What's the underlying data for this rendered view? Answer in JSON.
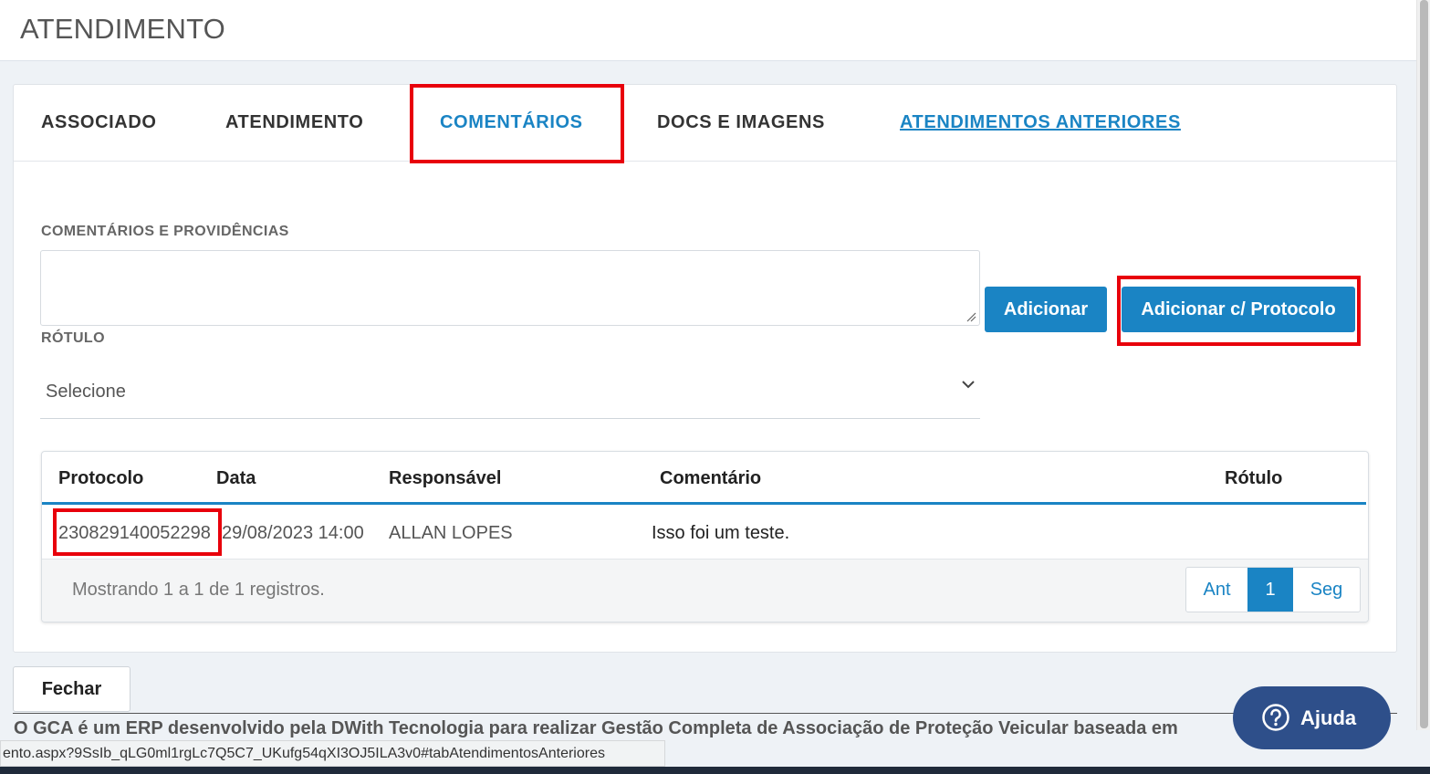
{
  "header": {
    "title": "ATENDIMENTO"
  },
  "tabs": [
    {
      "label": "ASSOCIADO"
    },
    {
      "label": "ATENDIMENTO"
    },
    {
      "label": "COMENTÁRIOS",
      "active": true
    },
    {
      "label": "DOCS E IMAGENS"
    },
    {
      "label": "ATENDIMENTOS ANTERIORES",
      "link": true
    }
  ],
  "form": {
    "comment_label": "COMENTÁRIOS E PROVIDÊNCIAS",
    "comment_value": "",
    "rotulo_label": "RÓTULO",
    "rotulo_selected": "Selecione",
    "add_button": "Adicionar",
    "add_protocol_button": "Adicionar c/ Protocolo"
  },
  "table": {
    "columns": [
      "Protocolo",
      "Data",
      "Responsável",
      "Comentário",
      "Rótulo"
    ],
    "rows": [
      {
        "protocolo": "230829140052298",
        "data": "29/08/2023 14:00",
        "responsavel": "ALLAN LOPES",
        "comentario": "Isso foi um teste.",
        "rotulo": ""
      }
    ],
    "info": "Mostrando 1 a 1 de 1 registros.",
    "pager": {
      "prev": "Ant",
      "current": "1",
      "next": "Seg"
    }
  },
  "close_button": "Fechar",
  "footer_text": "O GCA é um ERP desenvolvido pela DWith Tecnologia para realizar Gestão Completa de Associação de Proteção Veicular baseada em",
  "status_url": "ento.aspx?9SsIb_qLG0ml1rgLc7Q5C7_UKufg54qXI3OJ5ILA3v0#tabAtendimentosAnteriores",
  "help": {
    "label": "Ajuda",
    "icon": "question-circle-icon"
  },
  "colors": {
    "accent": "#1a84c4",
    "highlight": "#e8000b",
    "help_bg": "#2e4f8a"
  }
}
